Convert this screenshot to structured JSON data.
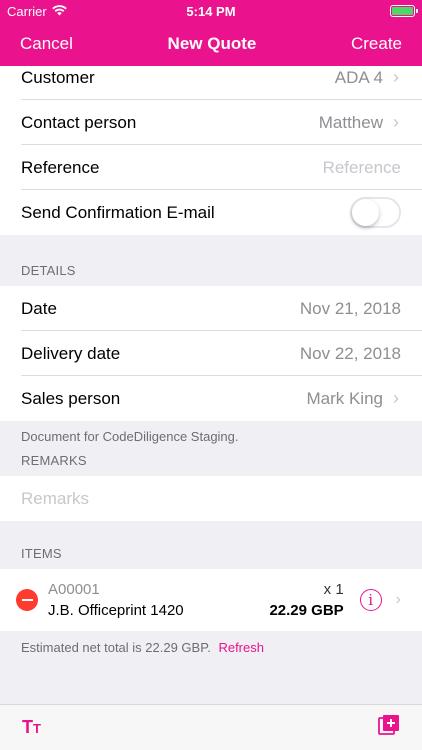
{
  "status_bar": {
    "carrier": "Carrier",
    "time": "5:14 PM"
  },
  "nav": {
    "cancel": "Cancel",
    "title": "New Quote",
    "create": "Create"
  },
  "general": {
    "customer": {
      "label": "Customer",
      "value": "ADA 4"
    },
    "contact": {
      "label": "Contact person",
      "value": "Matthew"
    },
    "reference": {
      "label": "Reference",
      "placeholder": "Reference"
    },
    "confirmation": {
      "label": "Send Confirmation E-mail",
      "enabled": false
    }
  },
  "details": {
    "header": "DETAILS",
    "date": {
      "label": "Date",
      "value": "Nov 21, 2018"
    },
    "delivery": {
      "label": "Delivery date",
      "value": "Nov 22, 2018"
    },
    "sales_person": {
      "label": "Sales person",
      "value": "Mark King"
    },
    "footer": "Document for CodeDiligence Staging."
  },
  "remarks": {
    "header": "REMARKS",
    "placeholder": "Remarks"
  },
  "items": {
    "header": "ITEMS",
    "list": [
      {
        "code": "A00001",
        "name": "J.B. Officeprint 1420",
        "qty": "x 1",
        "price": "22.29 GBP"
      }
    ],
    "estimate": "Estimated net total is 22.29 GBP.",
    "refresh": "Refresh"
  },
  "colors": {
    "accent": "#ea138d",
    "delete": "#ff3b30"
  }
}
